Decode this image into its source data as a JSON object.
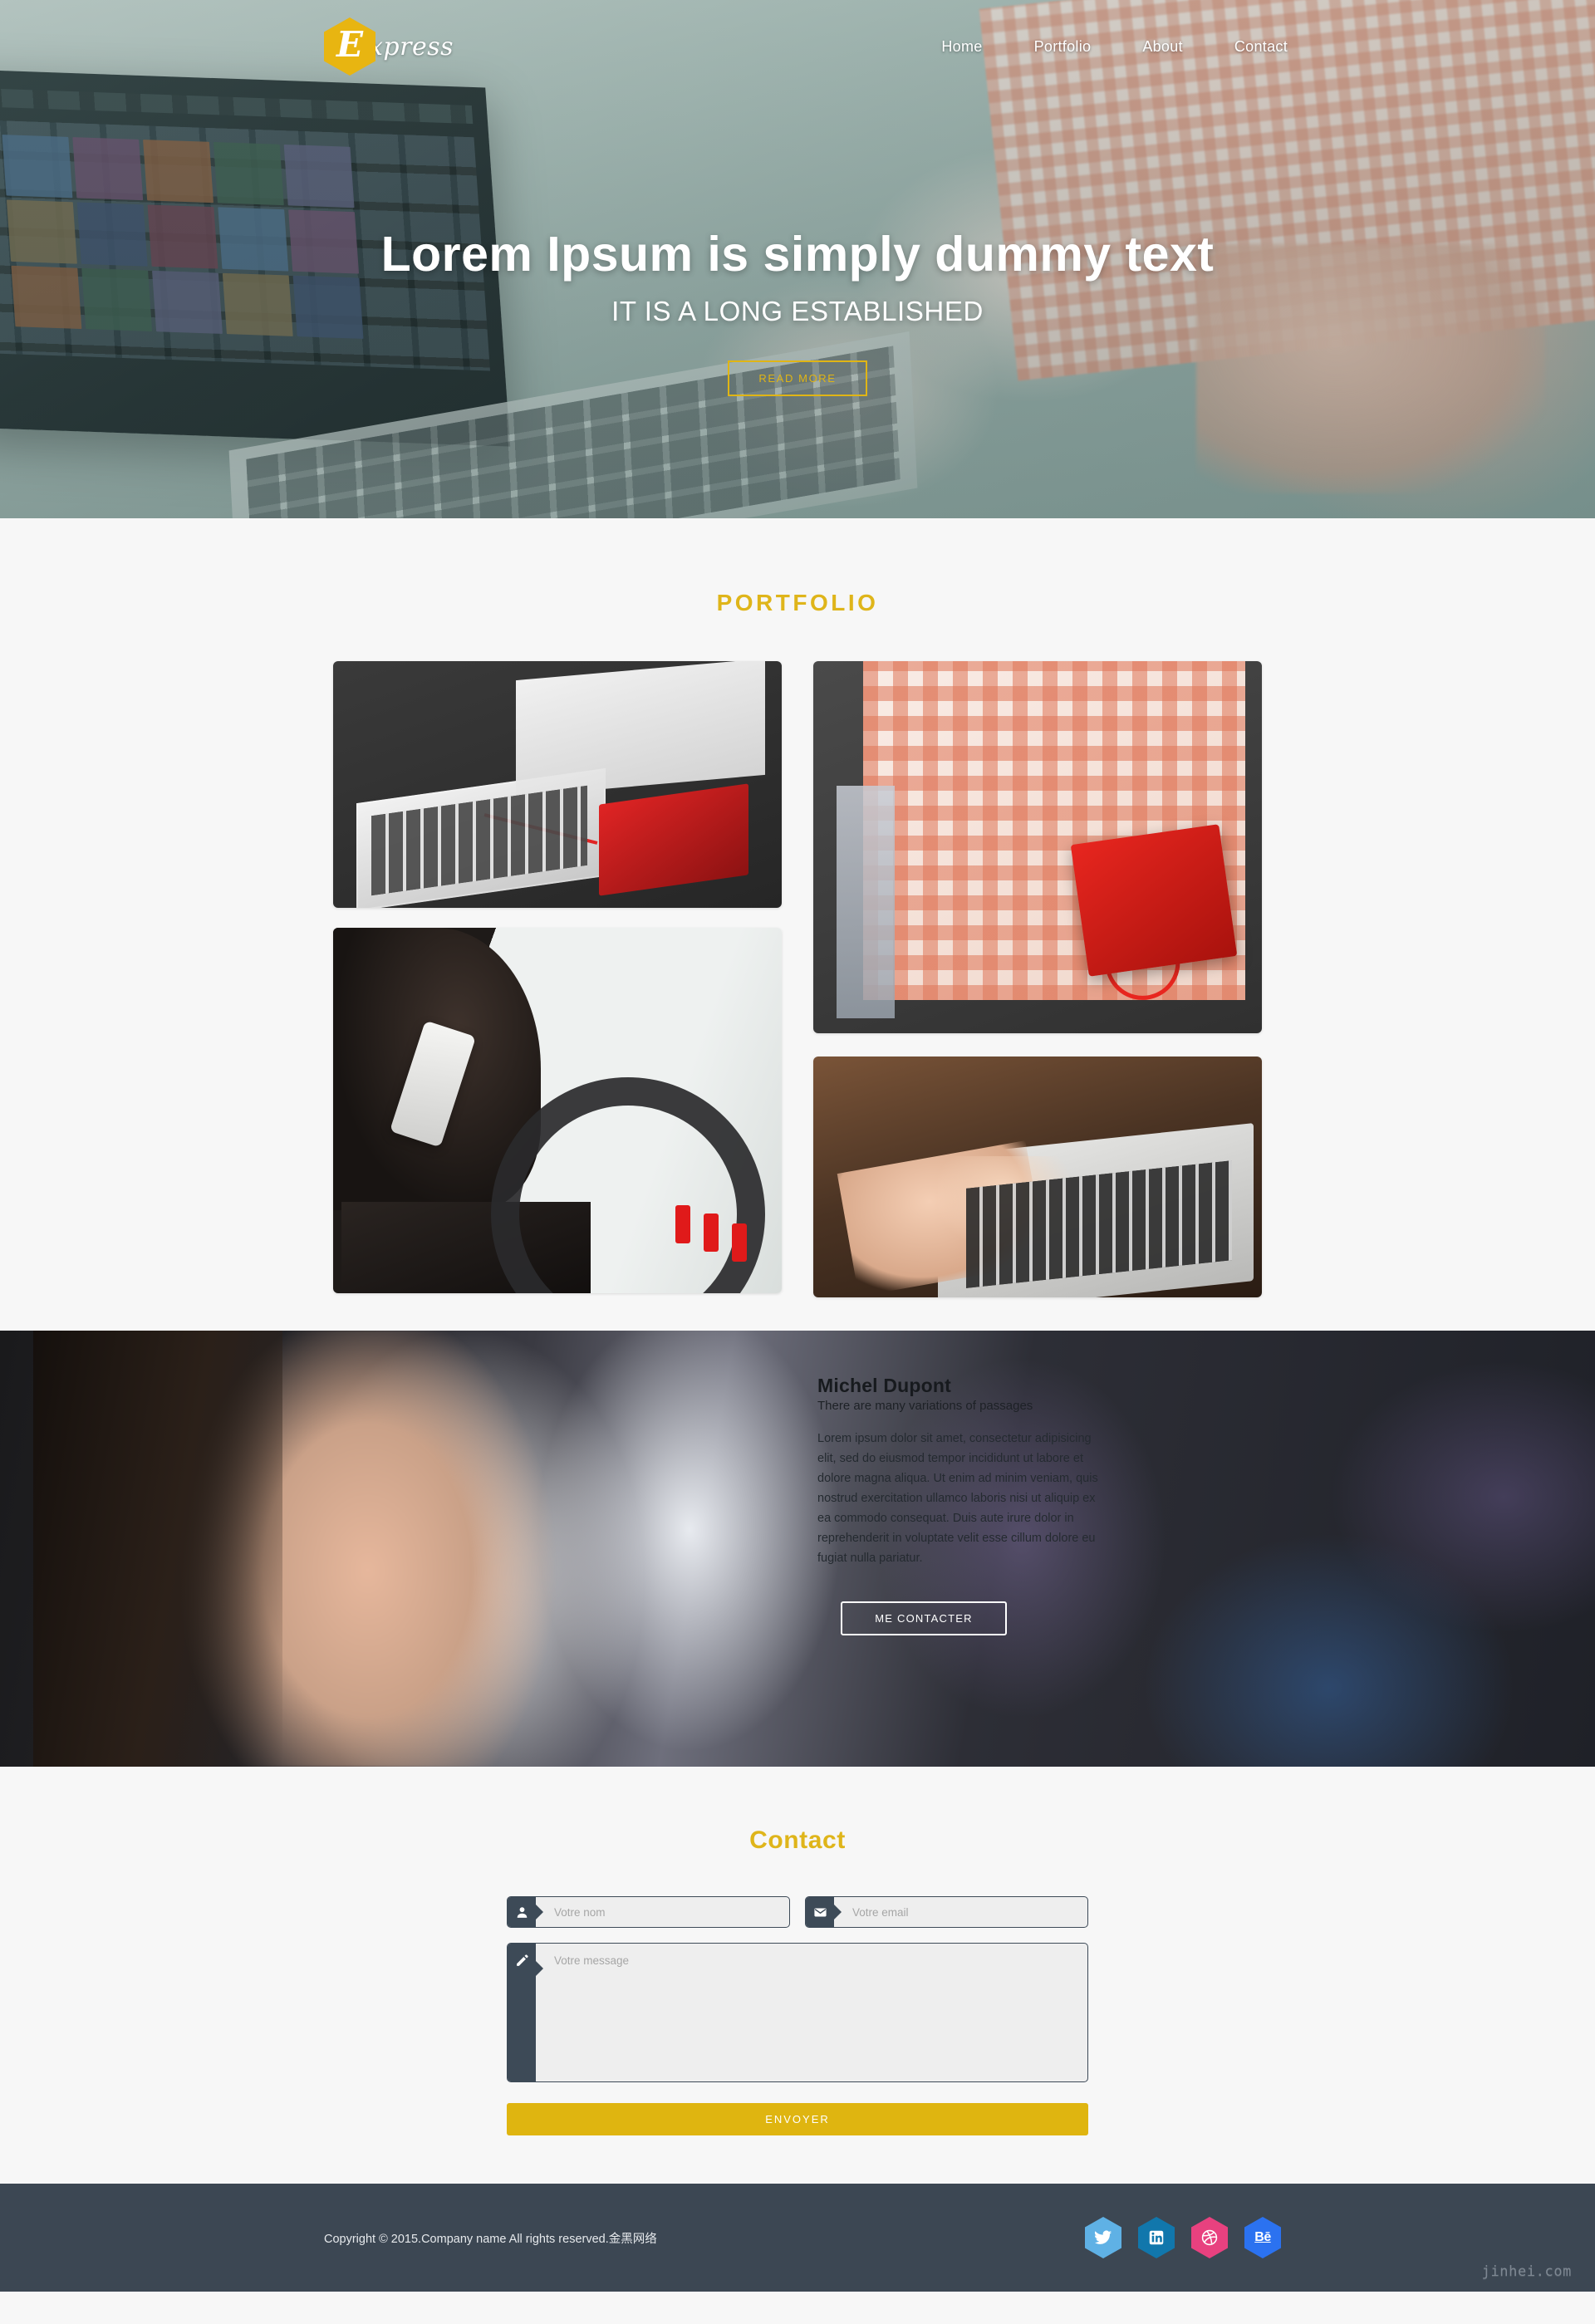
{
  "colors": {
    "gold": "#dfb51a",
    "gold_button": "#dfb510",
    "navy_field": "#3d4a57",
    "footer_bg": "#3c4753",
    "page_bg": "#f7f7f7"
  },
  "header": {
    "logo_letter": "E",
    "logo_text": "xpress",
    "nav": [
      {
        "label": "Home"
      },
      {
        "label": "Portfolio"
      },
      {
        "label": "About"
      },
      {
        "label": "Contact"
      }
    ]
  },
  "hero": {
    "title": "Lorem Ipsum is simply dummy text",
    "subtitle": "IT IS A LONG ESTABLISHED",
    "cta_label": "READ MORE"
  },
  "portfolio": {
    "title": "PORTFOLIO",
    "items": [
      {
        "alt": "laptop-and-notebook-on-desk"
      },
      {
        "alt": "woman-in-checked-shirt-writing-in-red-notebook"
      },
      {
        "alt": "man-on-phone-in-car"
      },
      {
        "alt": "hands-typing-on-laptop"
      }
    ]
  },
  "about": {
    "name": "Michel Dupont",
    "tagline": "There are many variations of passages",
    "body": "Lorem ipsum dolor sit amet, consectetur adipisicing elit, sed do eiusmod tempor incididunt ut labore et dolore magna aliqua. Ut enim ad minim veniam, quis nostrud exercitation ullamco laboris nisi ut aliquip ex ea commodo consequat. Duis aute irure dolor in reprehenderit in voluptate velit esse cillum dolore eu fugiat nulla pariatur.",
    "cta_label": "ME CONTACTER"
  },
  "contact": {
    "title": "Contact",
    "fields": {
      "name_placeholder": "Votre nom",
      "email_placeholder": "Votre email",
      "message_placeholder": "Votre message",
      "name_value": "",
      "email_value": "",
      "message_value": ""
    },
    "submit_label": "ENVOYER"
  },
  "footer": {
    "copyright": "Copyright © 2015.Company name All rights reserved.金黑网络",
    "socials": [
      {
        "name": "twitter",
        "label": "Twitter",
        "color": "#5fb1e5"
      },
      {
        "name": "linkedin",
        "label": "LinkedIn",
        "color": "#1177ac"
      },
      {
        "name": "dribbble",
        "label": "Dribbble",
        "color": "#e8417f"
      },
      {
        "name": "behance",
        "label": "Behance",
        "color": "#2b72f0",
        "glyph": "Bē"
      }
    ],
    "watermark": "jinhei.com"
  }
}
